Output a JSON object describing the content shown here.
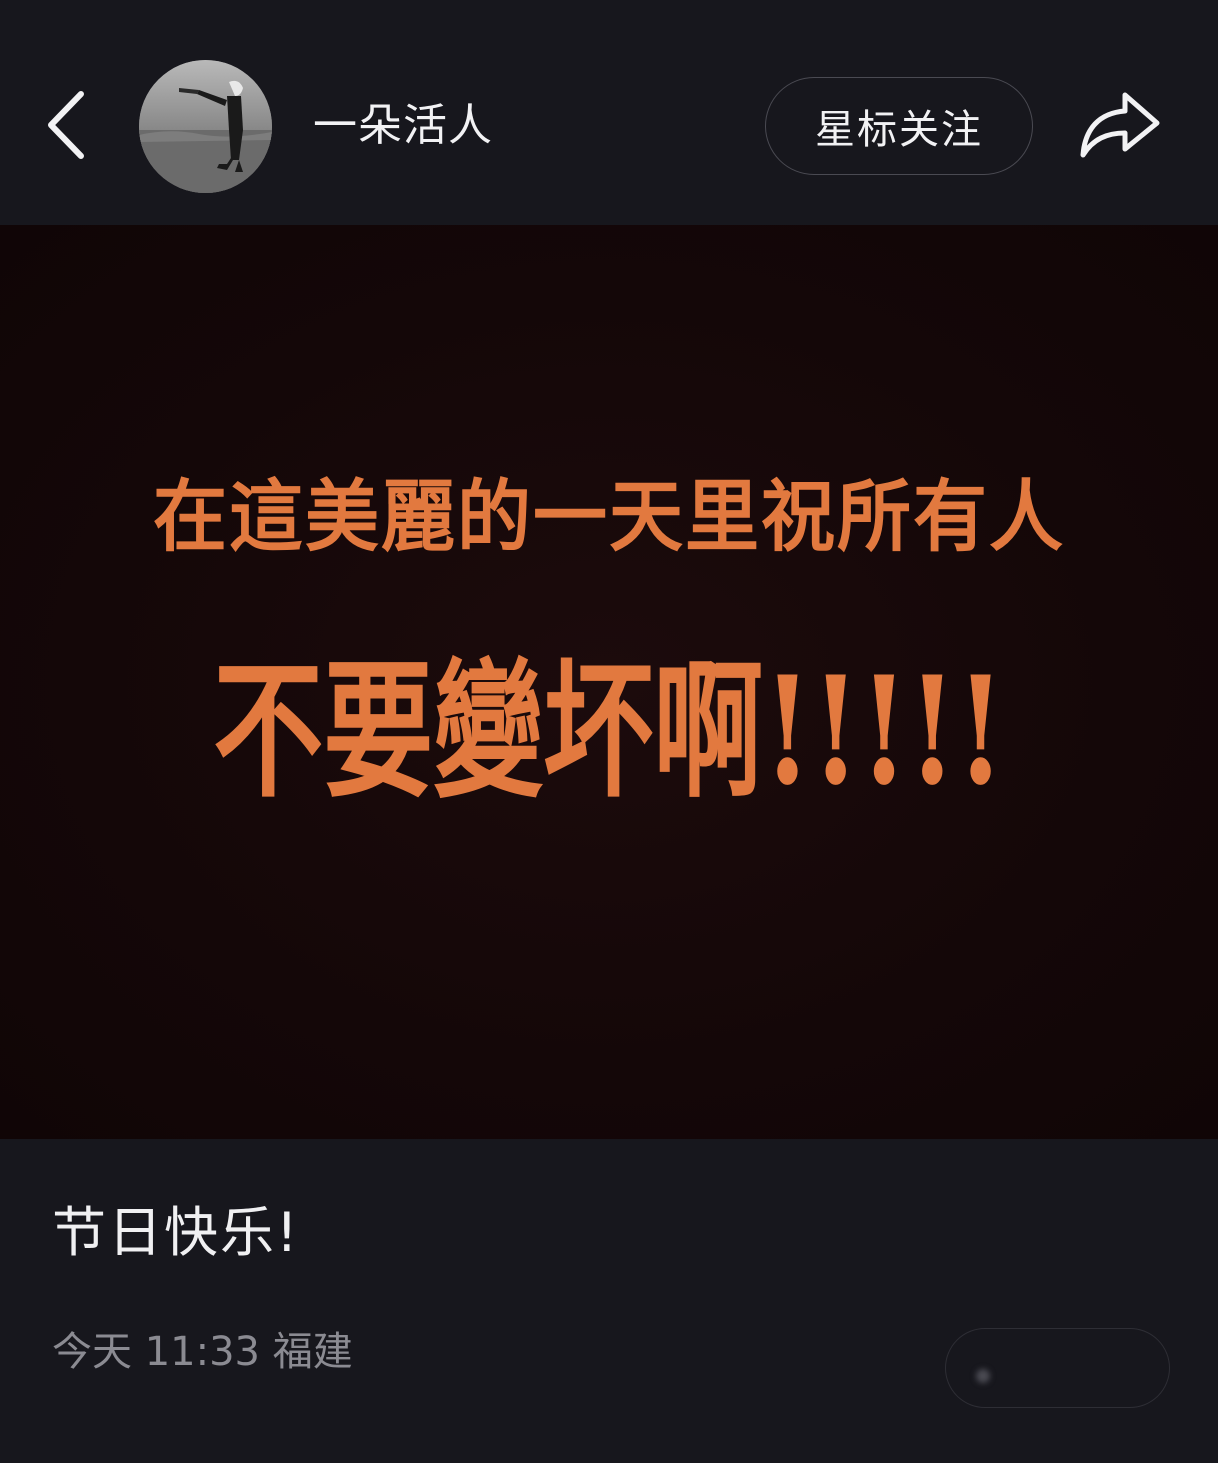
{
  "header": {
    "back_icon": "chevron-left-icon",
    "username": "一朵活人",
    "follow_label": "星标关注",
    "share_icon": "share-arrow-icon"
  },
  "post": {
    "image_text_line1": "在這美麗的一天里祝所有人",
    "image_text_line2": "不要變坏啊!!!!!",
    "image_text_color": "#e2793f",
    "caption": "节日快乐!",
    "date": "今天",
    "time": "11:33",
    "location": "福建"
  }
}
